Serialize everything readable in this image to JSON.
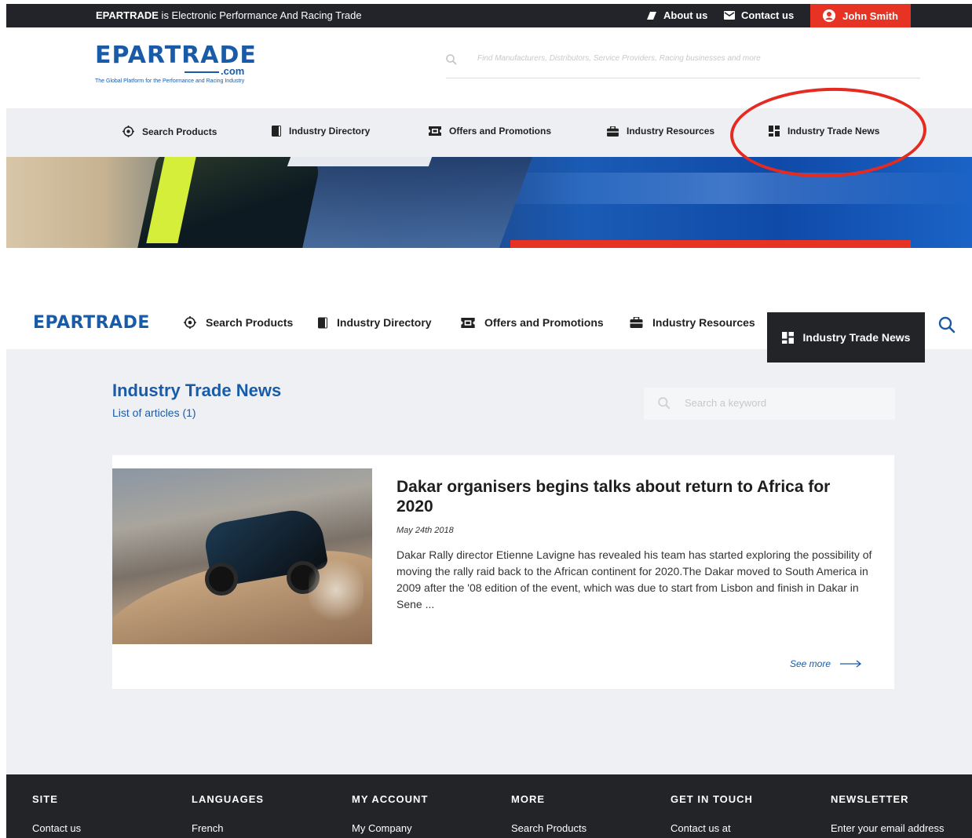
{
  "top": {
    "topbar": {
      "brand": "EPARTRADE",
      "tagline_rest": " is Electronic Performance And Racing Trade",
      "about_label": "About us",
      "contact_label": "Contact us",
      "user_label": "John Smith"
    },
    "logo": {
      "word": "EPARTRADE",
      "com": ".com",
      "tagline": "The Global Platform for the Performance and Racing Industry"
    },
    "search": {
      "placeholder": "Find Manufacturers, Distributors, Service Providers, Racing businesses and more"
    },
    "nav": [
      {
        "label": "Search Products",
        "icon": "target-icon"
      },
      {
        "label": "Industry Directory",
        "icon": "book-icon"
      },
      {
        "label": "Offers and Promotions",
        "icon": "ticket-icon"
      },
      {
        "label": "Industry Resources",
        "icon": "briefcase-icon"
      },
      {
        "label": "Industry Trade News",
        "icon": "grid-icon"
      }
    ]
  },
  "main": {
    "logo_small": "EPARTRADE",
    "nav": [
      {
        "label": "Search Products",
        "icon": "target-icon"
      },
      {
        "label": "Industry Directory",
        "icon": "book-icon"
      },
      {
        "label": "Offers and Promotions",
        "icon": "ticket-icon"
      },
      {
        "label": "Industry Resources",
        "icon": "briefcase-icon"
      },
      {
        "label": "Industry Trade News",
        "icon": "grid-icon"
      }
    ],
    "page_title": "Industry Trade News",
    "list_label": "List of articles (1)",
    "keyword_placeholder": "Search a keyword",
    "article": {
      "title": "Dakar organisers begins talks about return to Africa for 2020",
      "date": "May 24th 2018",
      "excerpt": "Dakar Rally director Etienne Lavigne has revealed his team has started exploring the possibility of moving the rally raid back to the African continent for 2020.The Dakar moved to South America in 2009 after the '08 edition of the event, which was due to start from Lisbon and finish in Dakar in Sene ...",
      "see_more": "See more"
    }
  },
  "footer": {
    "columns": [
      {
        "heading": "SITE",
        "first": "Contact us"
      },
      {
        "heading": "LANGUAGES",
        "first": "French"
      },
      {
        "heading": "MY ACCOUNT",
        "first": "My Company"
      },
      {
        "heading": "MORE",
        "first": "Search Products"
      },
      {
        "heading": "GET IN TOUCH",
        "first": "Contact us at"
      },
      {
        "heading": "NEWSLETTER",
        "first": "Enter your email address"
      }
    ]
  },
  "colors": {
    "brand_blue": "#1a5ba8",
    "accent_red": "#e63323",
    "dark": "#232428"
  }
}
